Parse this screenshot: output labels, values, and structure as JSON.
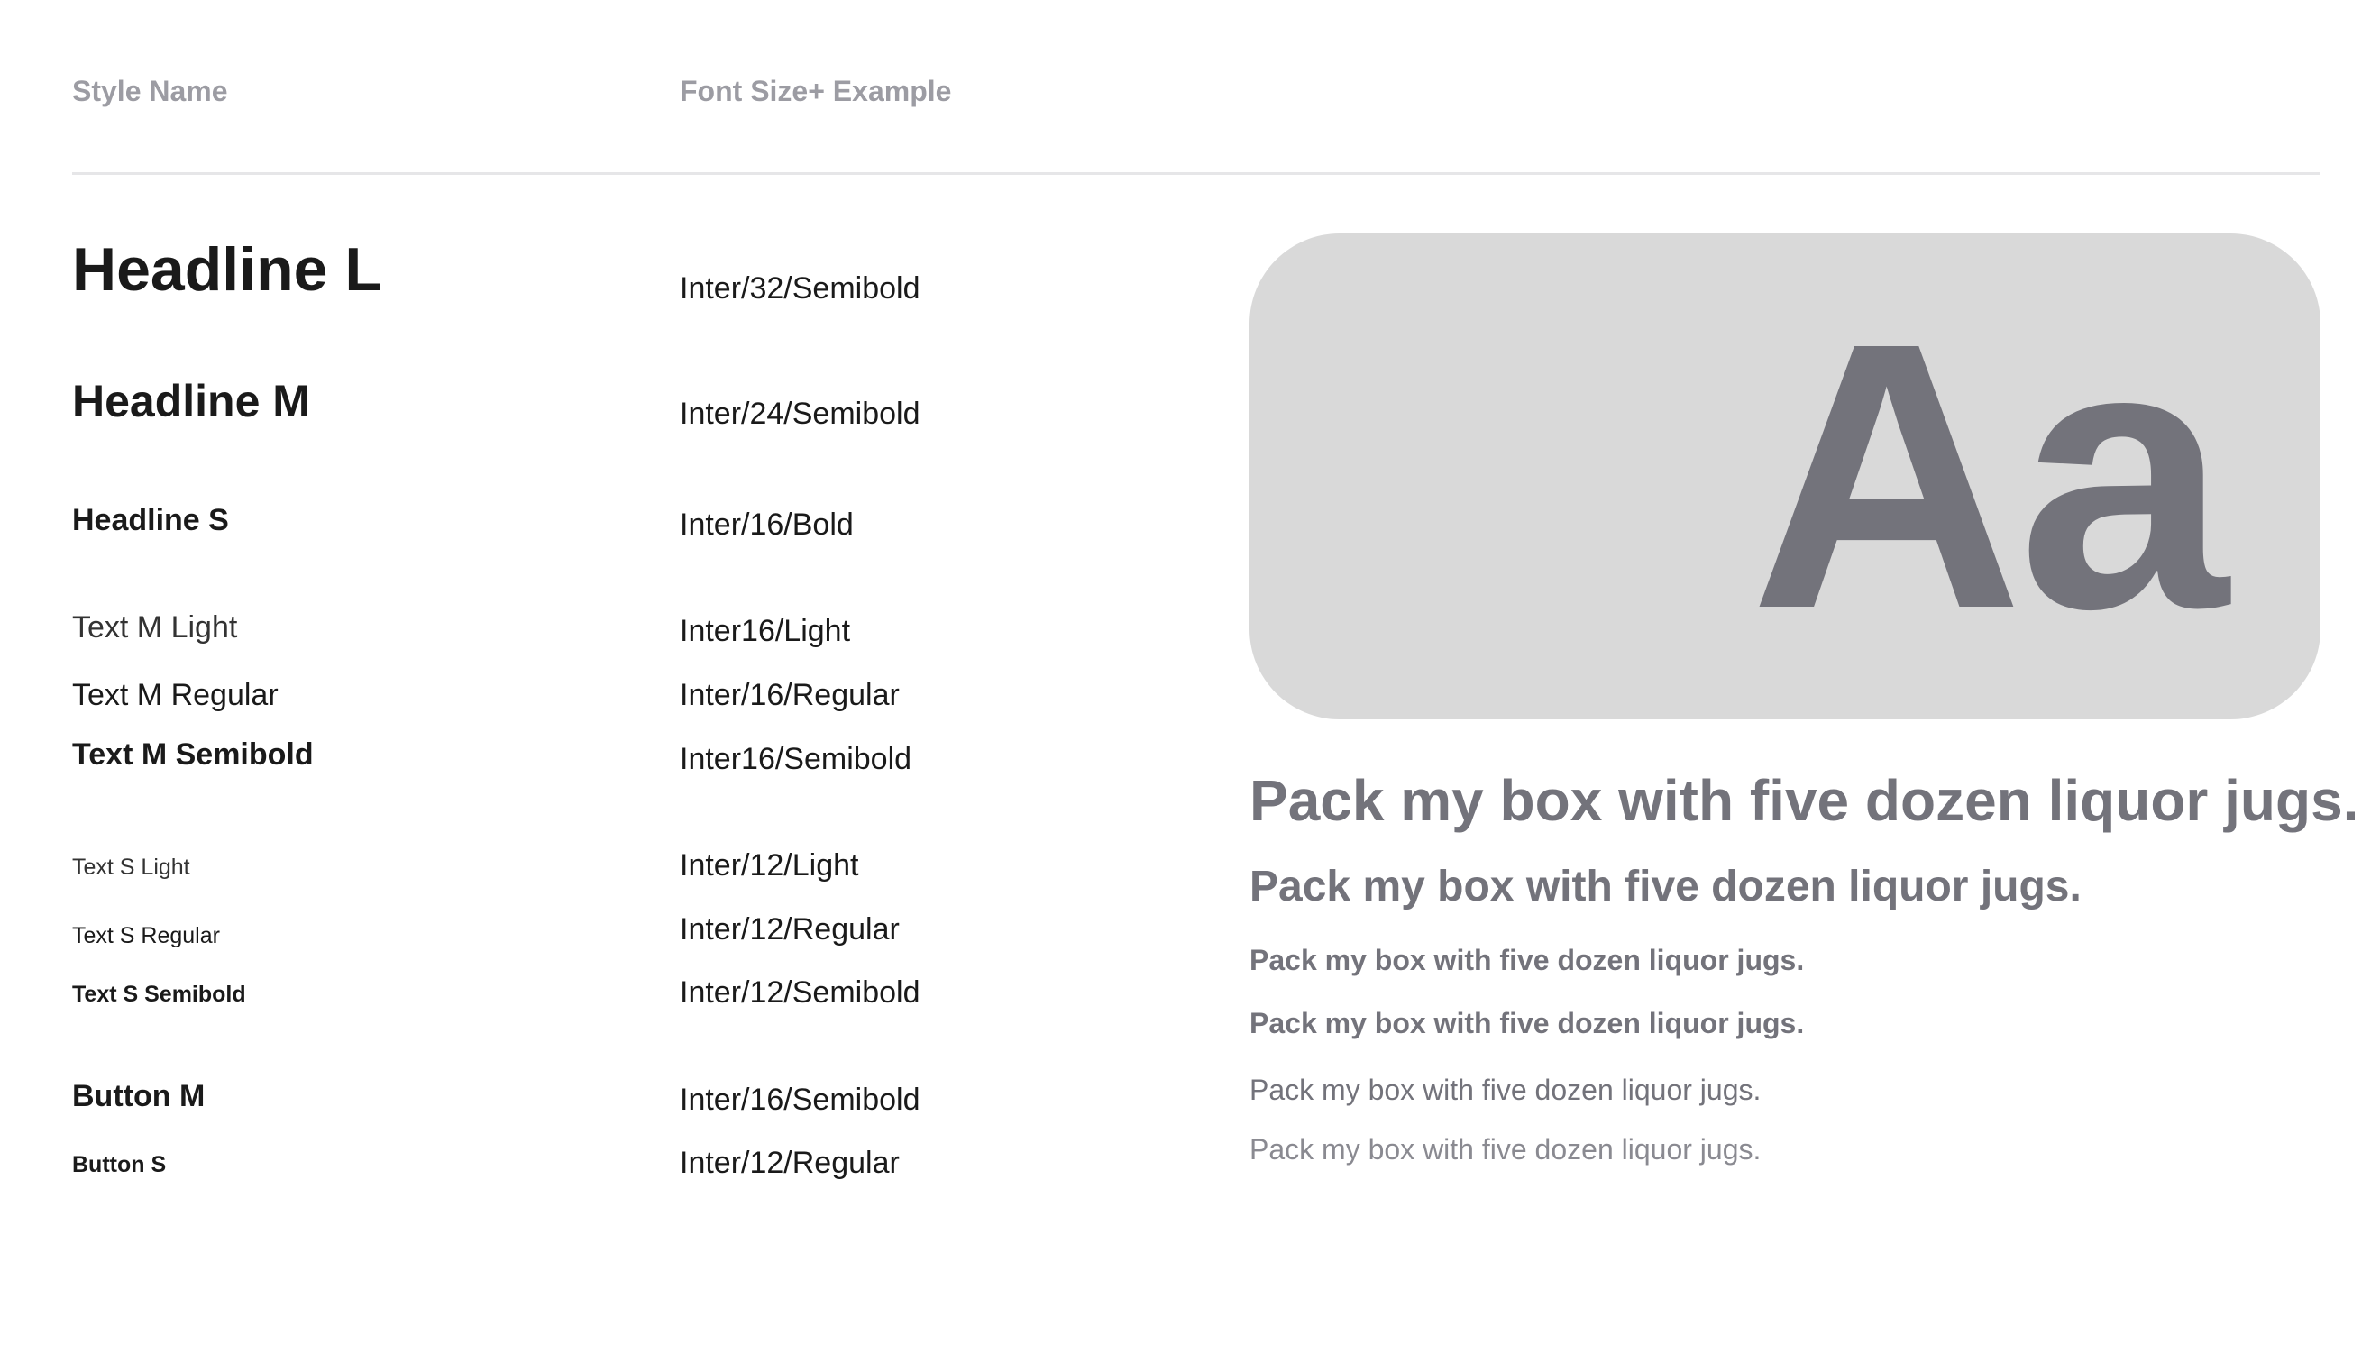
{
  "header": {
    "style_name_label": "Style Name",
    "example_label": "Font Size+ Example"
  },
  "styles": [
    {
      "name": "Headline L",
      "spec": "Inter/32/Semibold"
    },
    {
      "name": "Headline M",
      "spec": "Inter/24/Semibold"
    },
    {
      "name": "Headline S",
      "spec": "Inter/16/Bold"
    },
    {
      "name": "Text M Light",
      "spec": "Inter16/Light"
    },
    {
      "name": "Text M Regular",
      "spec": "Inter/16/Regular"
    },
    {
      "name": "Text M Semibold",
      "spec": "Inter16/Semibold"
    },
    {
      "name": "Text S Light",
      "spec": "Inter/12/Light"
    },
    {
      "name": "Text S Regular",
      "spec": "Inter/12/Regular"
    },
    {
      "name": "Text S Semibold",
      "spec": "Inter/12/Semibold"
    },
    {
      "name": "Button M",
      "spec": "Inter/16/Semibold"
    },
    {
      "name": "Button S",
      "spec": "Inter/12/Regular"
    }
  ],
  "preview": {
    "glyph": "Aa",
    "box_color": "#d9d9d9",
    "glyph_color": "#73737b"
  },
  "samples": [
    "Pack my box with five dozen liquor jugs.",
    "Pack my box with five dozen liquor jugs.",
    "Pack my box with five dozen liquor jugs.",
    "Pack my box with five dozen liquor jugs.",
    "Pack my box with five dozen liquor jugs.",
    "Pack my box with five dozen liquor jugs."
  ]
}
